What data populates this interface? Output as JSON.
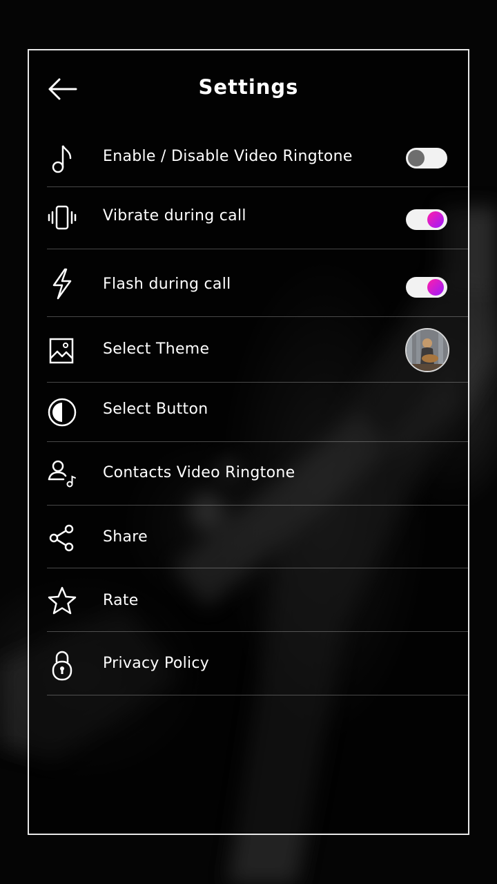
{
  "header": {
    "title": "Settings",
    "back_icon": "arrow-left-icon"
  },
  "settings": {
    "items": [
      {
        "label": "Enable / Disable Video Ringtone",
        "icon": "music-note-icon",
        "control": "toggle",
        "enabled": false
      },
      {
        "label": "Vibrate during call",
        "icon": "vibrate-icon",
        "control": "toggle",
        "enabled": true
      },
      {
        "label": "Flash during call",
        "icon": "flash-icon",
        "control": "toggle",
        "enabled": true
      },
      {
        "label": "Select Theme",
        "icon": "image-icon",
        "control": "theme-thumbnail"
      },
      {
        "label": "Select Button",
        "icon": "half-circle-icon"
      },
      {
        "label": "Contacts Video Ringtone",
        "icon": "contact-music-icon"
      },
      {
        "label": "Share",
        "icon": "share-icon"
      },
      {
        "label": "Rate",
        "icon": "star-icon"
      },
      {
        "label": "Privacy Policy",
        "icon": "lock-icon"
      }
    ]
  },
  "colors": {
    "background": "#050505",
    "panel_border": "#e9e9e9",
    "toggle_track": "#f2f2f2",
    "toggle_off_knob": "#6e6e6e",
    "toggle_on_knob_start": "#ff1fa8",
    "toggle_on_knob_end": "#9b1bff",
    "divider": "rgba(255,255,255,0.28)"
  }
}
